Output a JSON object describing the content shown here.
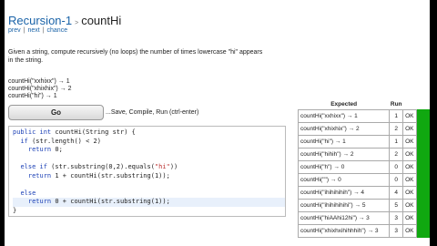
{
  "page": {
    "breadcrumb": {
      "section": "Recursion-1",
      "separator": ">",
      "problem": "countHi"
    },
    "nav": {
      "prev": "prev",
      "next": "next",
      "chance": "chance",
      "sep": "|"
    },
    "description_lines": [
      "Given a string, compute recursively (no loops) the number of times lowercase \"hi\" appears",
      "in the string."
    ],
    "examples": [
      "countHi(\"xxhixx\") → 1",
      "countHi(\"xhixhix\") → 2",
      "countHi(\"hi\") → 1"
    ],
    "go_button": "Go",
    "go_label": "...Save, Compile, Run (ctrl-enter)"
  },
  "code_lines": [
    [
      {
        "t": "public int ",
        "c": "kw"
      },
      {
        "t": "countHi(String str) {",
        "c": ""
      }
    ],
    [
      {
        "t": "  ",
        "c": ""
      },
      {
        "t": "if",
        "c": "kw"
      },
      {
        "t": " (str.length() < 2)",
        "c": ""
      }
    ],
    [
      {
        "t": "    ",
        "c": ""
      },
      {
        "t": "return",
        "c": "kw"
      },
      {
        "t": " 0;",
        "c": ""
      }
    ],
    [
      {
        "t": "",
        "c": ""
      }
    ],
    [
      {
        "t": "  ",
        "c": ""
      },
      {
        "t": "else if",
        "c": "kw"
      },
      {
        "t": " (str.substring(0,2).equals(",
        "c": ""
      },
      {
        "t": "\"hi\"",
        "c": "str"
      },
      {
        "t": "))",
        "c": ""
      }
    ],
    [
      {
        "t": "    ",
        "c": ""
      },
      {
        "t": "return",
        "c": "kw"
      },
      {
        "t": " 1 + countHi(str.substring(1));",
        "c": ""
      }
    ],
    [
      {
        "t": "",
        "c": ""
      }
    ],
    [
      {
        "t": "  ",
        "c": ""
      },
      {
        "t": "else",
        "c": "kw"
      }
    ],
    [
      {
        "t": "    ",
        "c": ""
      },
      {
        "t": "return",
        "c": "kw"
      },
      {
        "t": " 0 + countHi(str.substring(1));",
        "c": ""
      }
    ],
    [
      {
        "t": "}",
        "c": ""
      }
    ]
  ],
  "active_line": 8,
  "results": {
    "headers": {
      "expected": "Expected",
      "run": "Run"
    },
    "rows": [
      {
        "expected": "countHi(\"xxhixx\") → 1",
        "run": "1",
        "status": "OK"
      },
      {
        "expected": "countHi(\"xhixhix\") → 2",
        "run": "2",
        "status": "OK"
      },
      {
        "expected": "countHi(\"hi\") → 1",
        "run": "1",
        "status": "OK"
      },
      {
        "expected": "countHi(\"hihih\") → 2",
        "run": "2",
        "status": "OK"
      },
      {
        "expected": "countHi(\"h\") → 0",
        "run": "0",
        "status": "OK"
      },
      {
        "expected": "countHi(\"\") → 0",
        "run": "0",
        "status": "OK"
      },
      {
        "expected": "countHi(\"ihihihihih\") → 4",
        "run": "4",
        "status": "OK"
      },
      {
        "expected": "countHi(\"ihihihihihi\") → 5",
        "run": "5",
        "status": "OK"
      },
      {
        "expected": "countHi(\"hiAAhi12hi\") → 3",
        "run": "3",
        "status": "OK"
      },
      {
        "expected": "countHi(\"xhixhxihihhhih\") → 3",
        "run": "3",
        "status": "OK"
      }
    ],
    "pass_color": "#10a810"
  }
}
